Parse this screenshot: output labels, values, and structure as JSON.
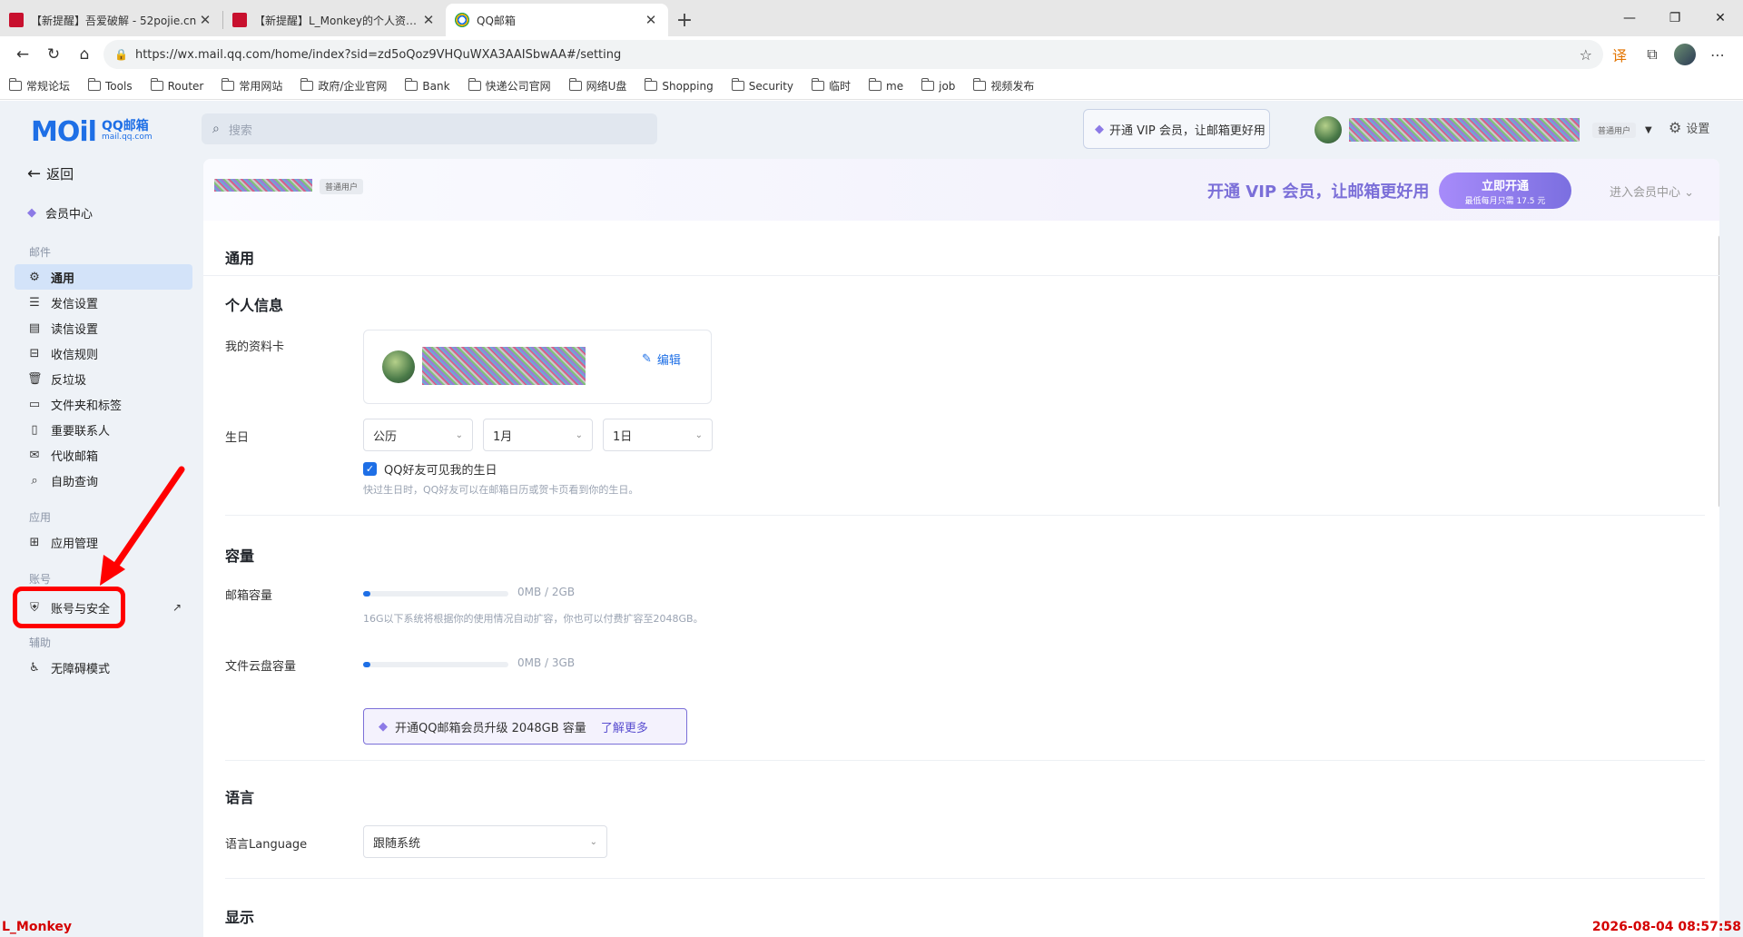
{
  "browser": {
    "tabs": [
      {
        "title": "【新提醒】吾爱破解 - 52pojie.cn",
        "active": false
      },
      {
        "title": "【新提醒】L_Monkey的个人资料 -",
        "active": false
      },
      {
        "title": "QQ邮箱",
        "active": true
      }
    ],
    "new_tab": "+",
    "url": "https://wx.mail.qq.com/home/index?sid=zd5oQoz9VHQuWXA3AAISbwAA#/setting",
    "bookmarks": [
      "常规论坛",
      "Tools",
      "Router",
      "常用网站",
      "政府/企业官网",
      "Bank",
      "快递公司官网",
      "网络U盘",
      "Shopping",
      "Security",
      "临时",
      "me",
      "job",
      "视频发布"
    ]
  },
  "app": {
    "logo_text": "MOil",
    "logo_cn": "QQ邮箱",
    "logo_domain": "mail.qq.com",
    "search_placeholder": "搜索",
    "vip_pill": "开通 VIP 会员，让邮箱更好用",
    "user_badge": "普通用户",
    "settings_label": "设置"
  },
  "sidebar": {
    "back": "返回",
    "vip_center": "会员中心",
    "section_mail": "邮件",
    "mail_items": [
      {
        "label": "通用",
        "icon": "gear-icon",
        "active": true
      },
      {
        "label": "发信设置",
        "icon": "send-settings-icon"
      },
      {
        "label": "读信设置",
        "icon": "read-settings-icon"
      },
      {
        "label": "收信规则",
        "icon": "inbox-rule-icon"
      },
      {
        "label": "反垃圾",
        "icon": "trash-icon"
      },
      {
        "label": "文件夹和标签",
        "icon": "folder-icon"
      },
      {
        "label": "重要联系人",
        "icon": "bookmark-icon"
      },
      {
        "label": "代收邮箱",
        "icon": "proxy-mail-icon"
      },
      {
        "label": "自助查询",
        "icon": "search-doc-icon"
      }
    ],
    "section_apps": "应用",
    "app_items": [
      {
        "label": "应用管理",
        "icon": "grid-icon"
      }
    ],
    "section_account": "账号",
    "account_items": [
      {
        "label": "账号与安全",
        "icon": "shield-icon"
      }
    ],
    "section_assist": "辅助",
    "assist_items": [
      {
        "label": "无障碍模式",
        "icon": "accessibility-icon"
      }
    ]
  },
  "banner": {
    "user_badge": "普通用户",
    "promo": "开通 VIP 会员，让邮箱更好用",
    "open_btn": "立即开通",
    "open_btn_sub": "最低每月只需 17.5 元",
    "member_center": "进入会员中心"
  },
  "settings": {
    "title": "通用",
    "personal": {
      "heading": "个人信息",
      "card_label": "我的资料卡",
      "edit": "编辑",
      "birthday_label": "生日",
      "calendar": "公历",
      "month": "1月",
      "day": "1日",
      "visible_label": "QQ好友可见我的生日",
      "visible_checked": true,
      "birthday_hint": "快过生日时，QQ好友可以在邮箱日历或贺卡页看到你的生日。"
    },
    "capacity": {
      "heading": "容量",
      "mail_label": "邮箱容量",
      "mail_value": "0MB / 2GB",
      "mail_fraction": 0.05,
      "mail_hint": "16G以下系统将根据你的使用情况自动扩容，你也可以付费扩容至2048GB。",
      "disk_label": "文件云盘容量",
      "disk_value": "0MB / 3GB",
      "disk_fraction": 0.05,
      "upgrade_text": "开通QQ邮箱会员升级 2048GB 容量",
      "upgrade_more": "了解更多"
    },
    "language": {
      "heading": "语言",
      "label": "语言Language",
      "value": "跟随系统"
    },
    "display": {
      "heading": "显示"
    }
  },
  "overlay": {
    "user": "L_Monkey",
    "timestamp": "2026-08-04 08:57:58",
    "highlight_color": "#ff0000"
  }
}
